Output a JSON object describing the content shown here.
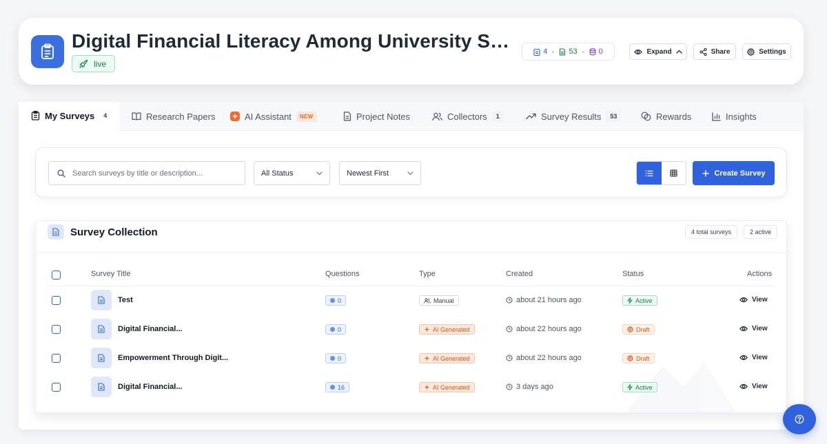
{
  "project": {
    "title": "Digital Financial Literacy Among University Stud...",
    "status": "live"
  },
  "stats": {
    "surveys": "4",
    "responses": "53",
    "data": "0"
  },
  "header_actions": {
    "expand": "Expand",
    "share": "Share",
    "settings": "Settings"
  },
  "tabs": [
    {
      "label": "My Surveys",
      "count": "4"
    },
    {
      "label": "Research Papers"
    },
    {
      "label": "AI Assistant",
      "badge": "NEW"
    },
    {
      "label": "Project Notes"
    },
    {
      "label": "Collectors",
      "count": "1"
    },
    {
      "label": "Survey Results",
      "count": "53"
    },
    {
      "label": "Rewards"
    },
    {
      "label": "Insights"
    }
  ],
  "toolbar": {
    "search_placeholder": "Search surveys by title or description...",
    "status_filter": "All Status",
    "sort": "Newest First",
    "create_label": "Create Survey"
  },
  "collection": {
    "title": "Survey Collection",
    "total": "4 total surveys",
    "active": "2 active",
    "columns": {
      "title": "Survey Title",
      "questions": "Questions",
      "type": "Type",
      "created": "Created",
      "status": "Status",
      "actions": "Actions"
    },
    "rows": [
      {
        "title": "Test",
        "questions": "0",
        "type": "Manual",
        "created": "about 21 hours ago",
        "status": "Active",
        "action": "View"
      },
      {
        "title": "Digital Financial...",
        "questions": "0",
        "type": "AI Generated",
        "created": "about 22 hours ago",
        "status": "Draft",
        "action": "View"
      },
      {
        "title": "Empowerment Through Digit...",
        "questions": "0",
        "type": "AI Generated",
        "created": "about 22 hours ago",
        "status": "Draft",
        "action": "View"
      },
      {
        "title": "Digital Financial...",
        "questions": "16",
        "type": "AI Generated",
        "created": "3 days ago",
        "status": "Active",
        "action": "View"
      }
    ]
  },
  "colors": {
    "primary": "#2f62dc",
    "active_green": "#15803d",
    "draft_orange": "#d9541c"
  }
}
